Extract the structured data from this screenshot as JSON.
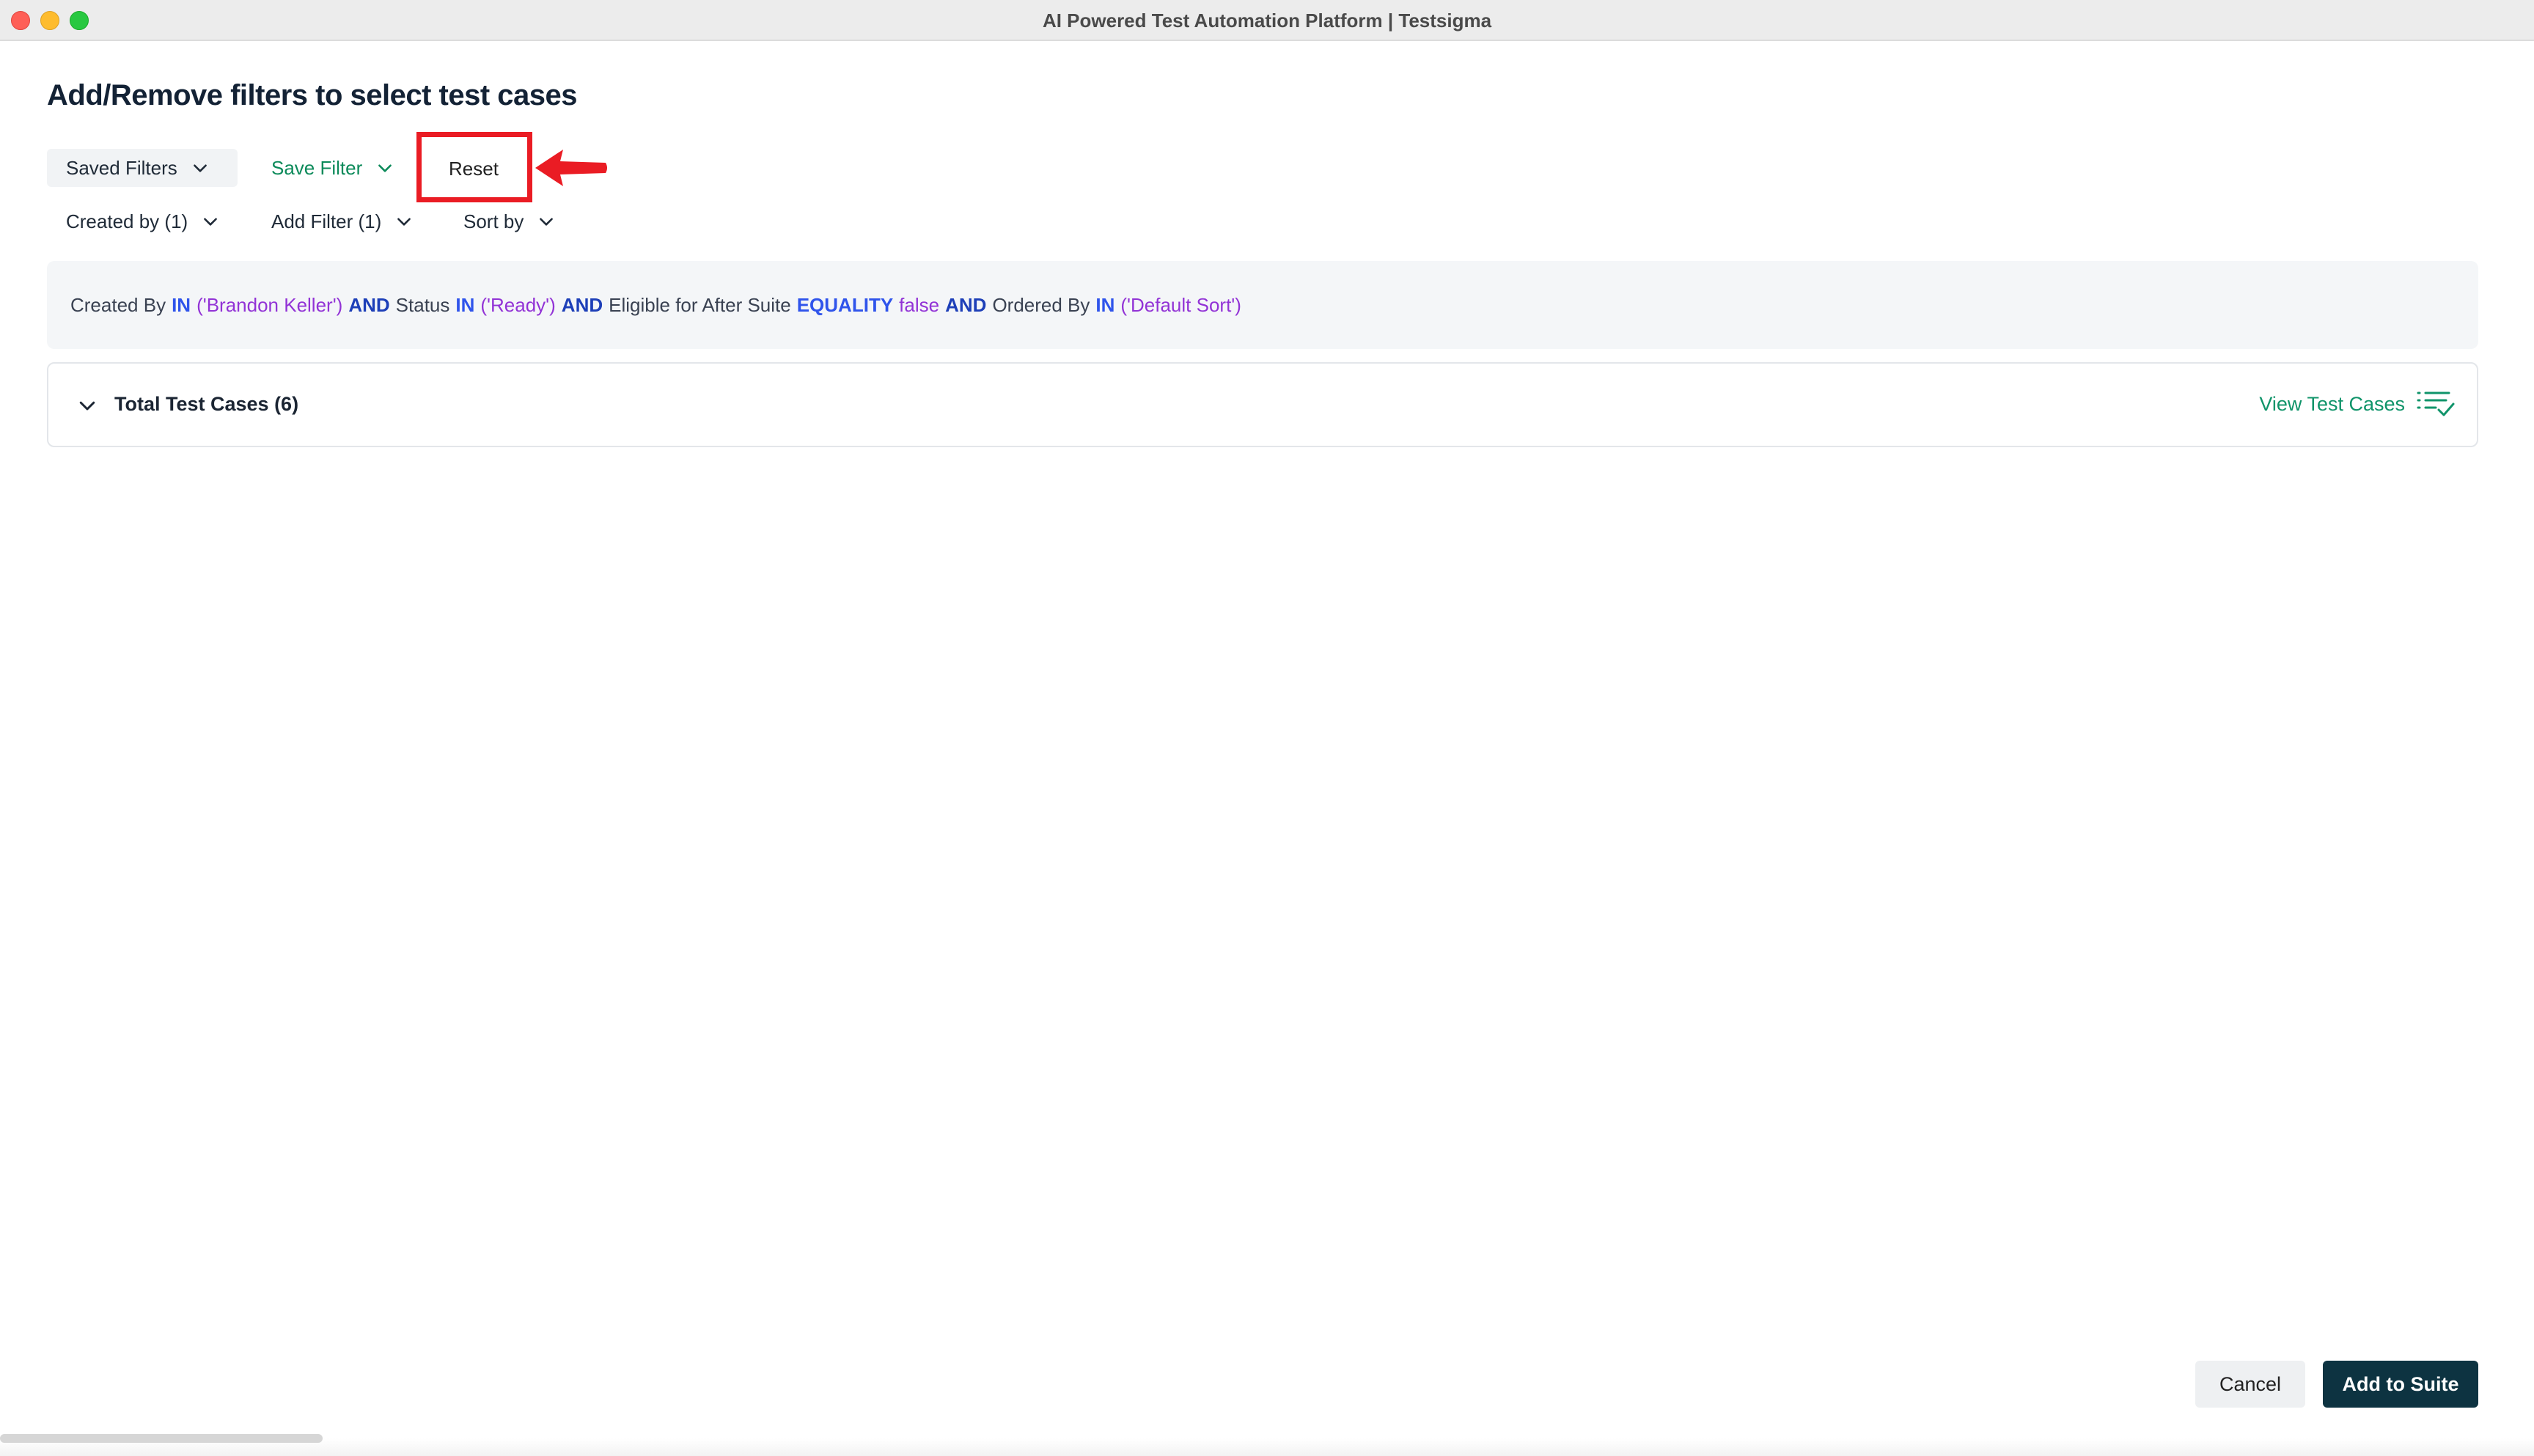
{
  "window": {
    "title": "AI Powered Test Automation Platform | Testsigma"
  },
  "page": {
    "title": "Add/Remove filters to select test cases"
  },
  "toolbar": {
    "saved_filters_label": "Saved Filters",
    "save_filter_label": "Save Filter",
    "reset_label": "Reset"
  },
  "filters": {
    "created_by_label": "Created by (1)",
    "add_filter_label": "Add Filter (1)",
    "sort_by_label": "Sort by"
  },
  "query": {
    "field1": "Created By",
    "op1": "IN",
    "val1": "('Brandon Keller')",
    "and1": "AND",
    "field2": "Status",
    "op2": "IN",
    "val2": "('Ready')",
    "and2": "AND",
    "field3": "Eligible for After Suite",
    "op3": "EQUALITY",
    "val3": "false",
    "and3": "AND",
    "field4": "Ordered By",
    "op4": "IN",
    "val4": "('Default Sort')"
  },
  "cases": {
    "title": "Total Test Cases (6)",
    "view_label": "View Test Cases"
  },
  "footer": {
    "cancel_label": "Cancel",
    "add_label": "Add to Suite"
  },
  "colors": {
    "accent_green": "#0c8a5a",
    "primary_dark": "#0d3341",
    "highlight_red": "#ea1c24",
    "query_keyword": "#2f54eb",
    "query_value": "#9233d6"
  }
}
